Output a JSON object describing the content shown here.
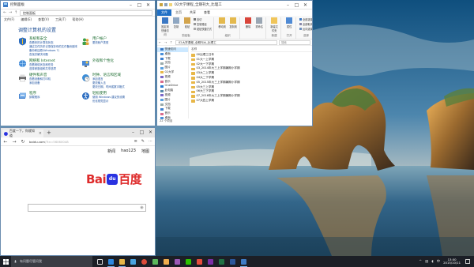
{
  "control_panel": {
    "title": "控制面板",
    "address": "控制面板",
    "menu": [
      "文件(F)",
      "编辑(E)",
      "查看(V)",
      "工具(T)",
      "帮助(H)"
    ],
    "heading": "调整计算机的设置",
    "categories": [
      {
        "title": "系统和安全",
        "links": [
          "查看你的计算机状态",
          "通过文件历史记录保存你的文件备份副本",
          "备份和还原(Windows 7)",
          "查找并解决问题"
        ]
      },
      {
        "title": "用户帐户",
        "links": [
          "更改帐户类型"
        ]
      },
      {
        "title": "网络和 Internet",
        "links": [
          "查看网络状态和任务",
          "选择家庭组和共享选项"
        ]
      },
      {
        "title": "外观和个性化",
        "links": []
      },
      {
        "title": "硬件和声音",
        "links": [
          "查看设备和打印机",
          "添加设备"
        ]
      },
      {
        "title": "时钟、语言和区域",
        "links": [
          "添加语言",
          "更改输入法",
          "更改日期、时间或数字格式"
        ]
      },
      {
        "title": "程序",
        "links": [
          "卸载程序"
        ]
      },
      {
        "title": "轻松使用",
        "links": [
          "使用 Windows 建议的设置",
          "优化视觉显示"
        ]
      }
    ]
  },
  "explorer": {
    "title": "02大学课程_全期刊大_比理工",
    "ribbon_tabs": [
      "文件",
      "主页",
      "共享",
      "查看"
    ],
    "ribbon_groups": [
      {
        "label": "剪贴板",
        "big": [
          "固定到快速访问",
          "复制",
          "粘贴"
        ],
        "small": [
          "剪切",
          "复制路径",
          "粘贴快捷方式"
        ]
      },
      {
        "label": "组织",
        "big": [
          "移动到",
          "复制到"
        ],
        "small": []
      },
      {
        "label": "",
        "big": [
          "删除",
          "重命名"
        ],
        "small": []
      },
      {
        "label": "新建",
        "big": [
          "新建文件夹"
        ],
        "small": []
      },
      {
        "label": "打开",
        "big": [
          "属性"
        ],
        "small": []
      },
      {
        "label": "选择",
        "big": [],
        "small": [
          "全部选择",
          "全部取消",
          "反向选择"
        ]
      }
    ],
    "address": "02大学课程_全期刊大_比理工",
    "search_placeholder": "搜索",
    "nav": [
      "快速访问",
      "桌面",
      "下载",
      "文档",
      "图片",
      "02大学",
      "视频",
      "音乐",
      "OneDrive",
      "此电脑",
      "视频",
      "图片",
      "文档",
      "下载",
      "音乐",
      "桌面",
      "本地磁盘 (C:)",
      "网络"
    ],
    "column_header": "名称",
    "files": [
      "00比理工日年",
      "01大一上学期",
      "02大一下学期",
      "03_2014年大三上学期暑期小学期",
      "03大二上学期",
      "04大二下学期",
      "05_2015年大三上学期暑期小学期",
      "05大三上学期",
      "06大三下学期",
      "07_2016年大三上学期暑期小学期",
      "07大四上学期"
    ],
    "status": "22 个项目"
  },
  "browser": {
    "tab_title": "百度一下，你就知道",
    "url": "baidu.com",
    "url_suffix": "/?tn=56060048",
    "top_links": [
      "新闻",
      "hao123",
      "地图"
    ],
    "logo_left": "Bai",
    "logo_paw": "du",
    "logo_right": "百度"
  },
  "taskbar": {
    "search_placeholder": "有问题尽管问我",
    "time": "13:00",
    "date": "2015/10/11",
    "lang": "中"
  }
}
